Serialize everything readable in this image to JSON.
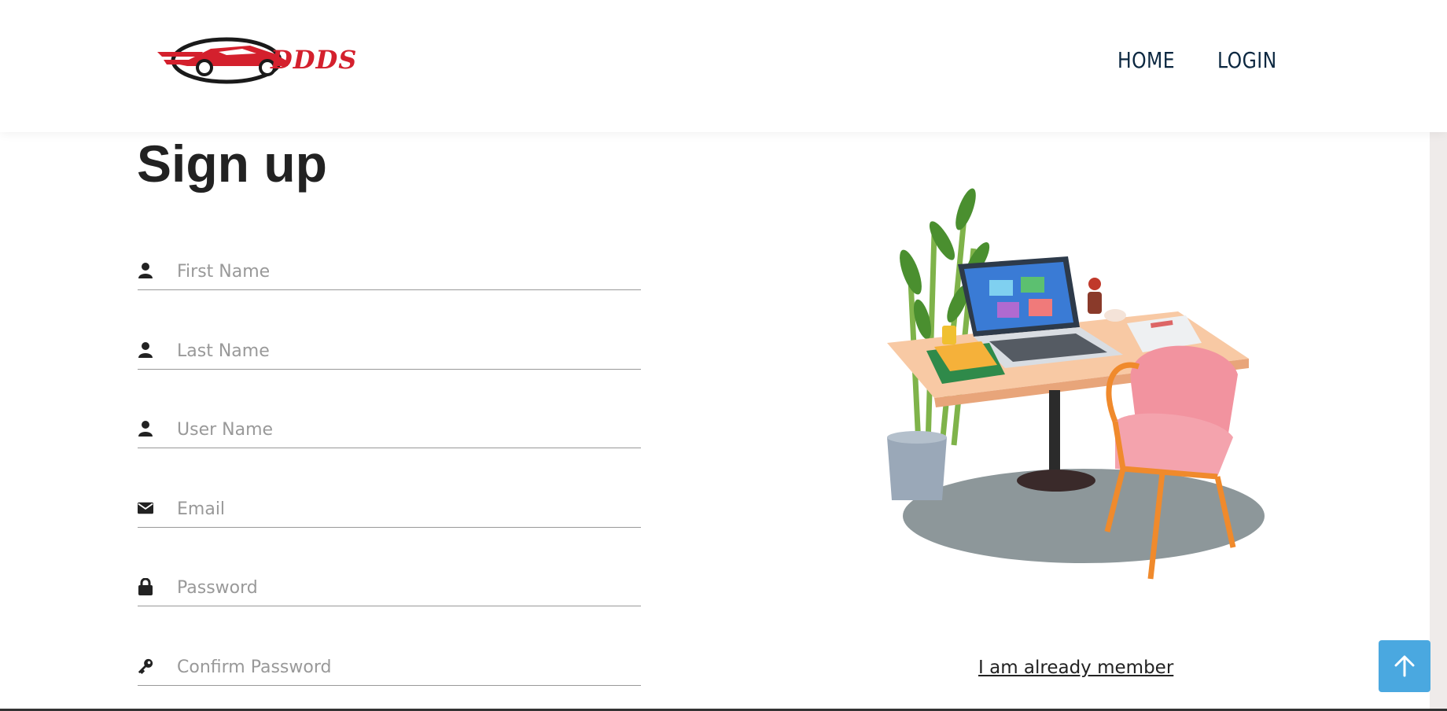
{
  "header": {
    "logo_text": "DDDS",
    "nav": [
      {
        "label": "HOME"
      },
      {
        "label": "LOGIN"
      }
    ]
  },
  "form": {
    "title": "Sign up",
    "fields": [
      {
        "placeholder": "First Name",
        "icon": "user-icon"
      },
      {
        "placeholder": "Last Name",
        "icon": "user-icon"
      },
      {
        "placeholder": "User Name",
        "icon": "user-icon"
      },
      {
        "placeholder": "Email",
        "icon": "envelope-icon"
      },
      {
        "placeholder": "Password",
        "icon": "lock-icon"
      },
      {
        "placeholder": "Confirm Password",
        "icon": "key-icon"
      }
    ]
  },
  "aside": {
    "member_link": "I am already member",
    "illustration": "desk-with-laptop-chair-plant"
  },
  "back_to_top_icon": "arrow-up-icon",
  "colors": {
    "brand_red": "#d4202d",
    "nav_text": "#0b2740",
    "accent_blue": "#4aa8e0"
  }
}
